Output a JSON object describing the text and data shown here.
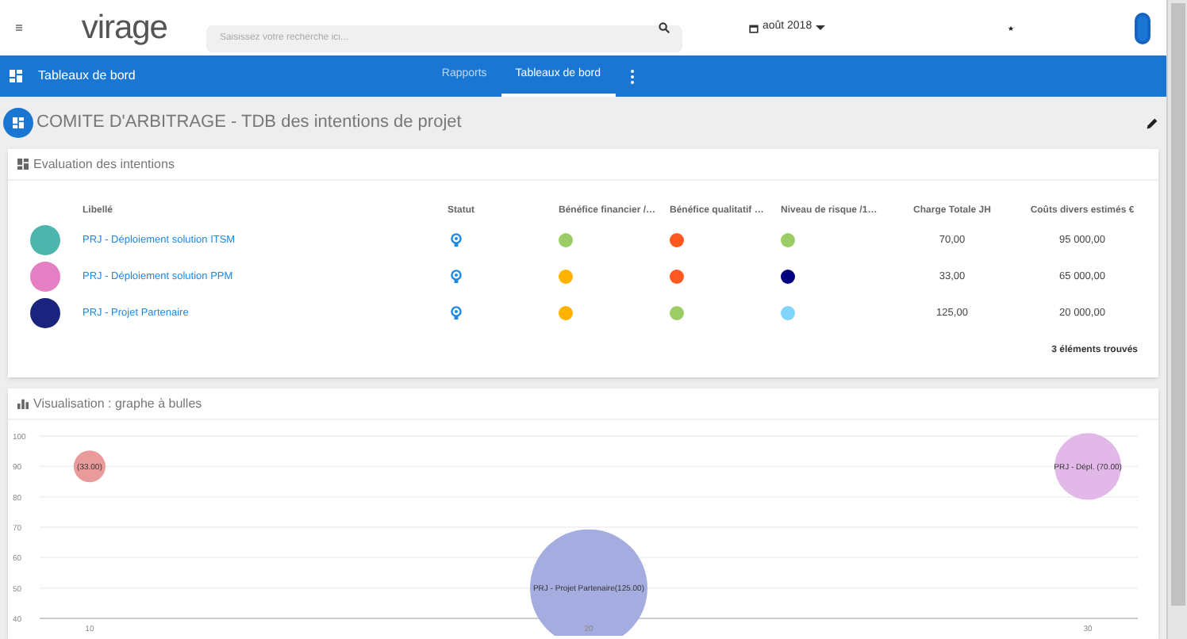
{
  "topbar": {
    "logo": "virage",
    "search": {
      "placeholder": "Saisissez votre recherche ici..."
    },
    "date": "août 2018"
  },
  "navbar": {
    "title": "Tableaux de bord",
    "tabs": [
      {
        "label": "Rapports",
        "selected": false
      },
      {
        "label": "Tableaux de bord",
        "selected": true
      }
    ]
  },
  "page_title": "COMITE D'ARBITRAGE - TDB des intentions de projet",
  "evaluation": {
    "title": "Evaluation des intentions",
    "columns": [
      "Libellé",
      "Statut",
      "Bénéfice financier /…",
      "Bénéfice qualitatif …",
      "Niveau de risque /1…",
      "Charge Totale JH",
      "Coûts divers estimés €"
    ],
    "rows": [
      {
        "avatar": {
          "color": "#4db6ac"
        },
        "label": "PRJ - Déploiement solution ITSM",
        "benefice_financier": {
          "color": "#9ccc65"
        },
        "benefice_qualitatif": {
          "color": "#ff5722"
        },
        "risque": {
          "color": "#9ccc65"
        },
        "charge": "70,00",
        "couts": "95 000,00"
      },
      {
        "avatar": {
          "color": "#e57fc4"
        },
        "label": "PRJ - Déploiement solution PPM",
        "benefice_financier": {
          "color": "#ffb300"
        },
        "benefice_qualitatif": {
          "color": "#ff5722"
        },
        "risque": {
          "color": "#000080"
        },
        "charge": "33,00",
        "couts": "65 000,00"
      },
      {
        "avatar": {
          "color": "#1a237e"
        },
        "label": "PRJ - Projet Partenaire",
        "benefice_financier": {
          "color": "#ffb300"
        },
        "benefice_qualitatif": {
          "color": "#9ccc65"
        },
        "risque": {
          "color": "#81d4fa"
        },
        "charge": "125,00",
        "couts": "20 000,00"
      }
    ],
    "count": "3 éléments trouvés"
  },
  "visualisation": {
    "title": "Visualisation : graphe à bulles",
    "chart_data": {
      "type": "scatter",
      "xlim": [
        9,
        31
      ],
      "ylim": [
        40,
        100
      ],
      "grid": true,
      "xticks": [
        10,
        20,
        30
      ],
      "yticks": [
        40,
        50,
        60,
        70,
        80,
        90,
        100
      ],
      "x": [
        10,
        20,
        30
      ],
      "series": [
        {
          "name": "(33.00)",
          "color": "#e99a9a",
          "values": [
            90,
            null,
            null
          ]
        },
        {
          "name": "PRJ - Projet Partenaire(125.00)",
          "color": "#a5acdf",
          "values": [
            null,
            50,
            null
          ]
        },
        {
          "name": "PRJ - Dépl. (70.00)",
          "color": "#e2b8e8",
          "values": [
            null,
            null,
            90
          ]
        }
      ]
    }
  }
}
